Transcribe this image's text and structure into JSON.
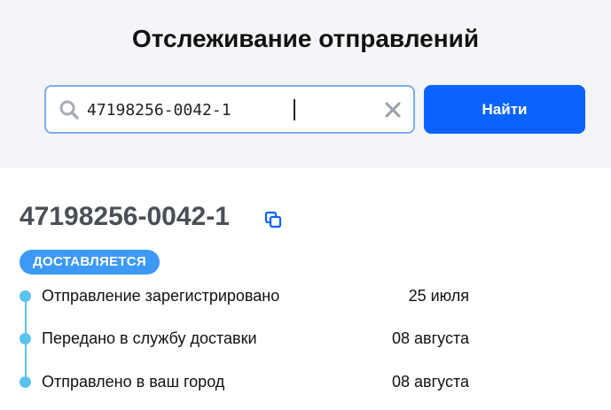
{
  "header": {
    "title": "Отслеживание отправлений",
    "search": {
      "value": "47198256-0042-1",
      "placeholder": ""
    },
    "find_label": "Найти"
  },
  "result": {
    "tracking_number": "47198256-0042-1",
    "status": "ДОСТАВЛЯЕТСЯ",
    "events": [
      {
        "label": "Отправление зарегистрировано",
        "date": "25 июля"
      },
      {
        "label": "Передано в службу доставки",
        "date": "08 августа"
      },
      {
        "label": "Отправлено в ваш город",
        "date": "08 августа"
      }
    ]
  },
  "colors": {
    "accent": "#0a63ff",
    "badge": "#3d99f5",
    "timeline": "#5bc3f0",
    "input_border": "#7aaee9"
  }
}
